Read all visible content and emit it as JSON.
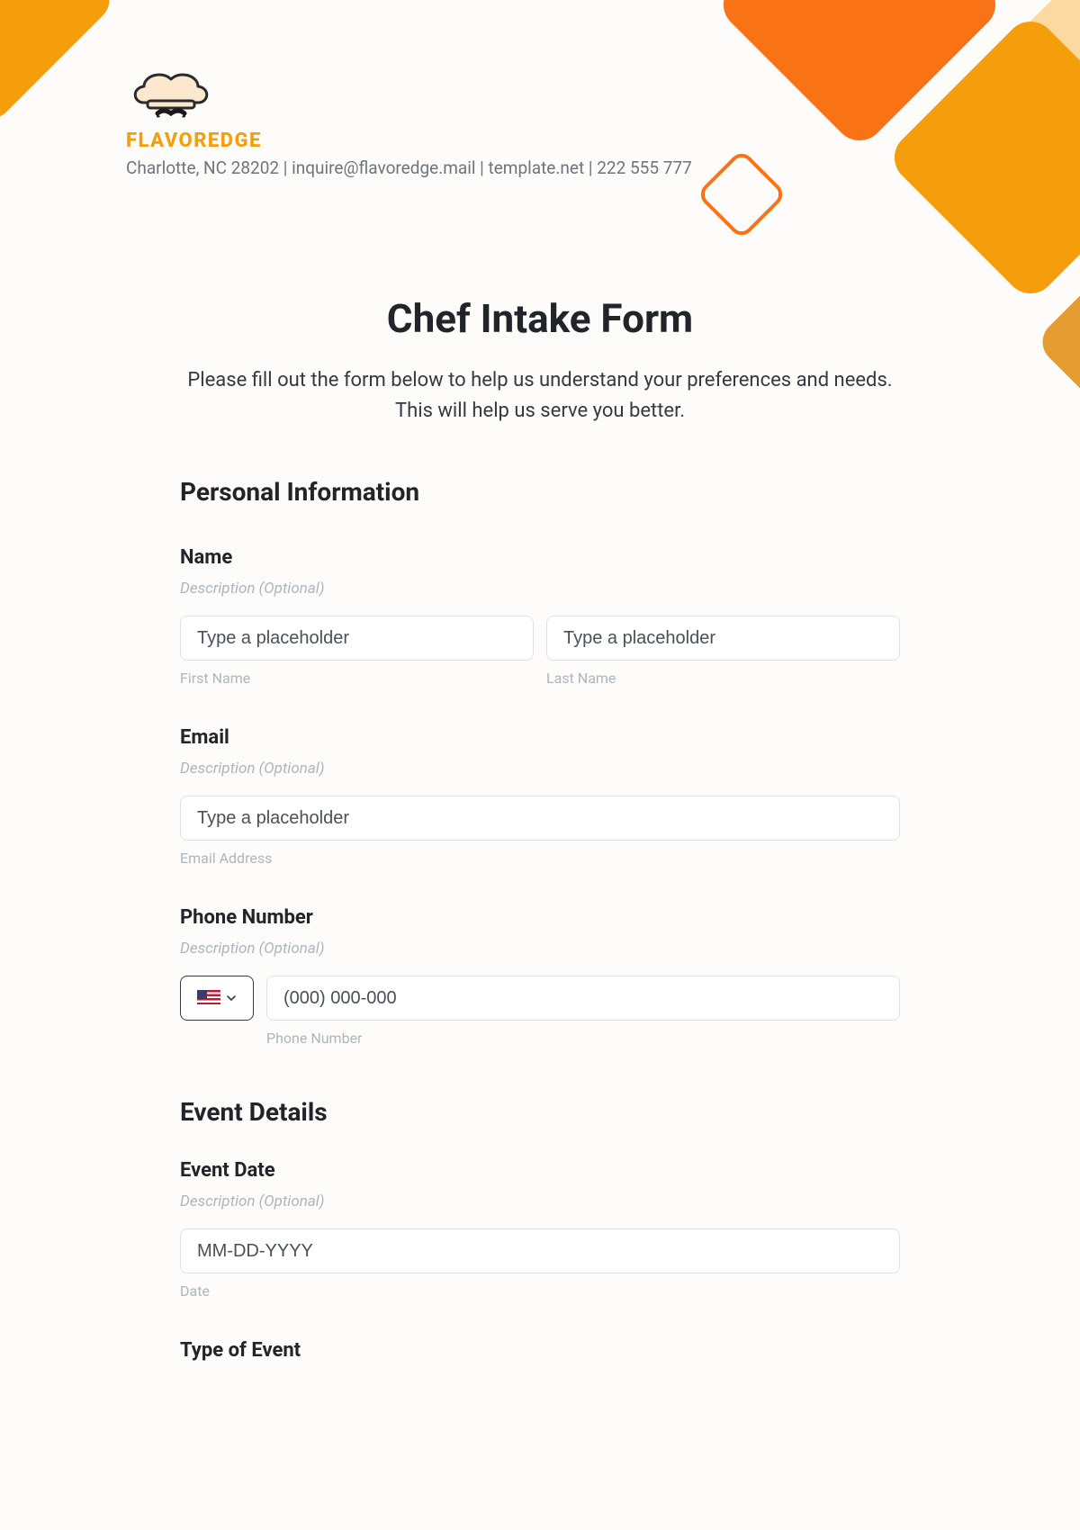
{
  "brand": {
    "name": "FLAVOREDGE",
    "contact": "Charlotte, NC 28202 | inquire@flavoredge.mail | template.net | 222 555 777"
  },
  "form": {
    "title": "Chef Intake Form",
    "intro": "Please fill out the form below to help us understand your preferences and needs. This will help us serve you better."
  },
  "sections": {
    "personal": {
      "heading": "Personal Information"
    },
    "event": {
      "heading": "Event Details"
    }
  },
  "fields": {
    "name": {
      "label": "Name",
      "desc": "Description (Optional)",
      "first_placeholder": "Type a placeholder",
      "last_placeholder": "Type a placeholder",
      "first_sub": "First Name",
      "last_sub": "Last Name"
    },
    "email": {
      "label": "Email",
      "desc": "Description (Optional)",
      "placeholder": "Type a placeholder",
      "sub": "Email Address"
    },
    "phone": {
      "label": "Phone Number",
      "desc": "Description (Optional)",
      "placeholder": "(000) 000-000",
      "sub": "Phone Number"
    },
    "event_date": {
      "label": "Event Date",
      "desc": "Description (Optional)",
      "placeholder": "MM-DD-YYYY",
      "sub": "Date"
    },
    "event_type": {
      "label": "Type of Event"
    }
  }
}
